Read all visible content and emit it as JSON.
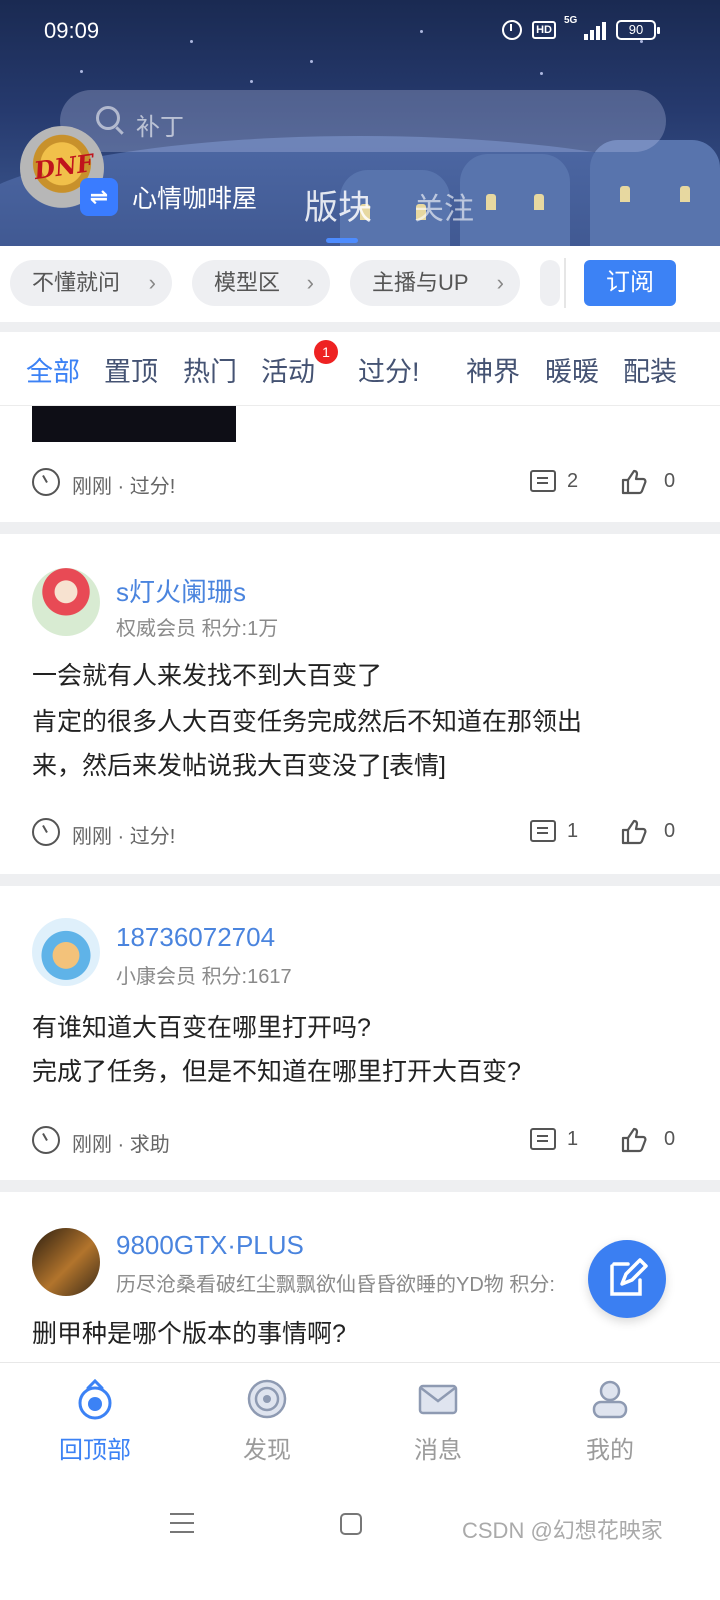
{
  "status_bar": {
    "time": "09:09",
    "hd": "HD",
    "network": "5G",
    "battery": "90"
  },
  "header": {
    "search_placeholder": "补丁",
    "board_name": "心情咖啡屋",
    "tabs": [
      {
        "label": "版块",
        "active": true
      },
      {
        "label": "关注",
        "active": false
      }
    ]
  },
  "chips": {
    "items": [
      "不懂就问",
      "模型区",
      "主播与UP"
    ],
    "subscribe_label": "订阅"
  },
  "categories": {
    "items": [
      "全部",
      "置顶",
      "热门",
      "活动",
      "过分!",
      "神界",
      "暖暖",
      "配装"
    ],
    "active": "全部",
    "activity_badge": "1"
  },
  "posts": [
    {
      "time": "刚刚",
      "tag": "过分!",
      "comments": "2",
      "likes": "0"
    },
    {
      "username": "s灯火阑珊s",
      "rank": "权威会员",
      "points": "积分:1万",
      "lines": [
        "一会就有人来发找不到大百变了",
        "肯定的很多人大百变任务完成然后不知道在那领出",
        "来，然后来发帖说我大百变没了[表情]"
      ],
      "time": "刚刚",
      "tag": "过分!",
      "comments": "1",
      "likes": "0"
    },
    {
      "username": "18736072704",
      "rank": "小康会员",
      "points": "积分:1617",
      "lines": [
        "有谁知道大百变在哪里打开吗?",
        "完成了任务，但是不知道在哪里打开大百变?"
      ],
      "time": "刚刚",
      "tag": "求助",
      "comments": "1",
      "likes": "0"
    },
    {
      "username": "9800GTX·PLUS",
      "rank": "历尽沧桑看破红尘飘飘欲仙昏昏欲睡的YD物",
      "points": "积分:",
      "lines": [
        "删甲种是哪个版本的事情啊?"
      ]
    }
  ],
  "bottom_nav": {
    "items": [
      {
        "label": "回顶部",
        "icon": "back-to-top-icon",
        "active": true
      },
      {
        "label": "发现",
        "icon": "discover-icon",
        "active": false
      },
      {
        "label": "消息",
        "icon": "message-icon",
        "active": false
      },
      {
        "label": "我的",
        "icon": "profile-icon",
        "active": false
      }
    ]
  },
  "watermark": "CSDN @幻想花映家",
  "colors": {
    "accent": "#3c82f5",
    "username": "#4a84de",
    "badge": "#ee2222"
  }
}
